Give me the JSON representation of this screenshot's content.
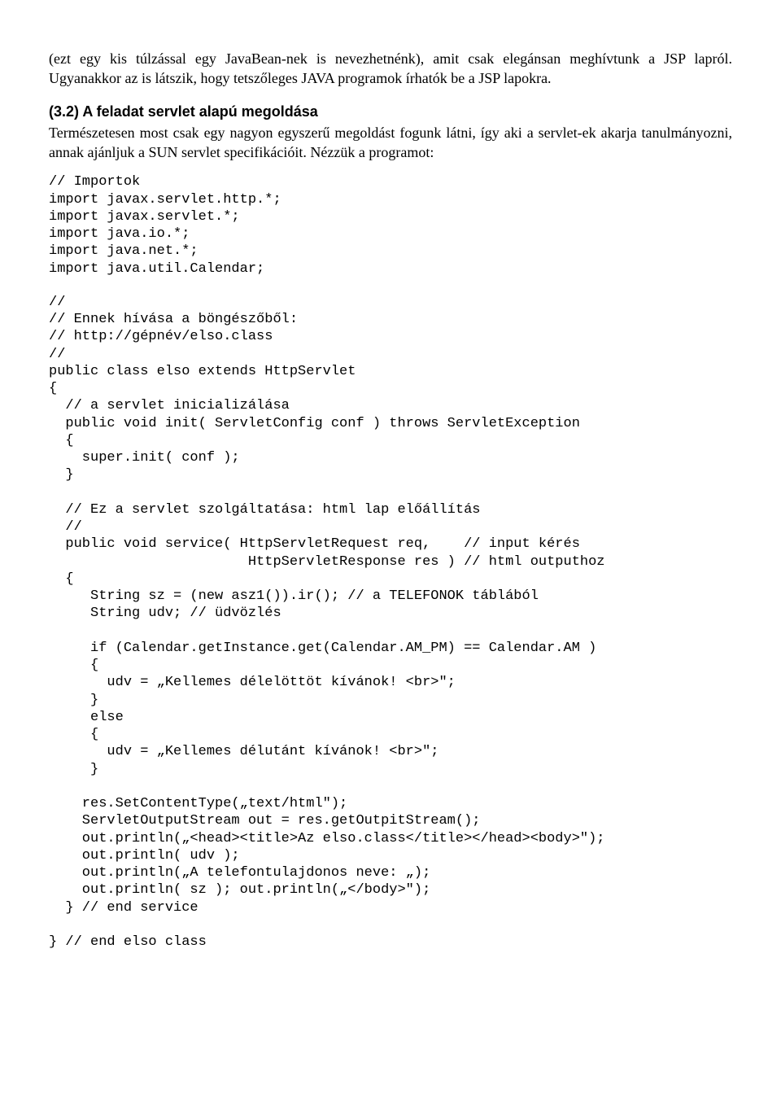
{
  "intro": "(ezt egy kis túlzással egy JavaBean-nek is nevezhetnénk), amit csak elegánsan meghívtunk a JSP lapról. Ugyanakkor az is látszik, hogy tetszőleges JAVA programok írhatók be a JSP lapokra.",
  "heading": "(3.2) A feladat servlet alapú megoldása",
  "desc": "Természetesen most csak egy nagyon egyszerű megoldást fogunk látni, így aki a servlet-ek akarja tanulmányozni, annak ajánljuk a SUN servlet specifikációit. Nézzük a programot:",
  "code1": "// Importok\nimport javax.servlet.http.*;\nimport javax.servlet.*;\nimport java.io.*;\nimport java.net.*;\nimport java.util.Calendar;",
  "code2": "//\n// Ennek hívása a böngészőből:\n// http://gépnév/elso.class\n//\npublic class elso extends HttpServlet\n{\n  // a servlet inicializálása\n  public void init( ServletConfig conf ) throws ServletException\n  {\n    super.init( conf );\n  }\n\n  // Ez a servlet szolgáltatása: html lap előállítás\n  //\n  public void service( HttpServletRequest req,    // input kérés\n                        HttpServletResponse res ) // html outputhoz\n  {\n     String sz = (new asz1()).ir(); // a TELEFONOK táblából\n     String udv; // üdvözlés\n\n     if (Calendar.getInstance.get(Calendar.AM_PM) == Calendar.AM )\n     {\n       udv = „Kellemes délelöttöt kívánok! <br>\";\n     }\n     else\n     {\n       udv = „Kellemes délutánt kívánok! <br>\";\n     }\n\n    res.SetContentType(„text/html\");\n    ServletOutputStream out = res.getOutpitStream();\n    out.println(„<head><title>Az elso.class</title></head><body>\");\n    out.println( udv );\n    out.println(„A telefontulajdonos neve: „);\n    out.println( sz ); out.println(„</body>\");\n  } // end service\n\n} // end elso class"
}
